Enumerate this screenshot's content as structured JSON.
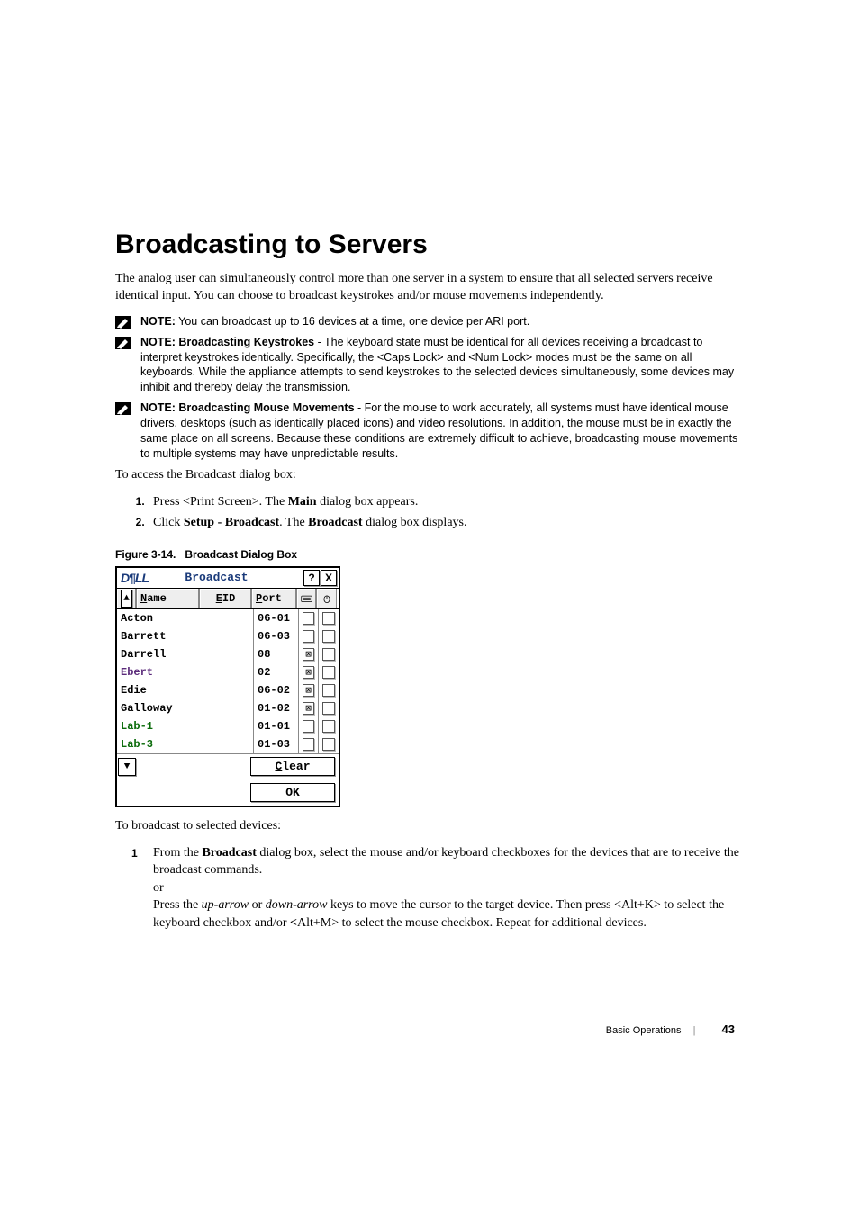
{
  "heading": "Broadcasting to Servers",
  "intro": "The analog user can simultaneously control more than one server in a system to ensure that all selected servers receive identical input. You can choose to broadcast keystrokes and/or mouse movements independently.",
  "notes": [
    {
      "label": "NOTE:",
      "strong": "",
      "text": " You can broadcast up to 16 devices at a time, one device per ARI port."
    },
    {
      "label": "NOTE:",
      "strong": " Broadcasting Keystrokes",
      "text": " - The keyboard state must be identical for all devices receiving a broadcast to interpret keystrokes identically. Specifically, the <Caps Lock> and <Num Lock> modes must be the same on all keyboards. While the appliance attempts to send keystrokes to the selected devices simultaneously, some devices may inhibit and thereby delay the transmission."
    },
    {
      "label": "NOTE:",
      "strong": "  Broadcasting Mouse Movements",
      "text": " - For the mouse to work accurately, all systems must have identical mouse drivers, desktops (such as identically placed icons) and video resolutions. In addition, the mouse must be in exactly the same place on all screens. Because these conditions are extremely difficult to achieve, broadcasting mouse movements to multiple systems may have unpredictable results."
    }
  ],
  "access_line": "To access the Broadcast dialog box:",
  "steps_access": [
    {
      "pre": "Press <Print Screen>. The ",
      "b1": "Main",
      "post": " dialog box appears."
    },
    {
      "pre": "Click ",
      "b1": "Setup - Broadcast",
      "mid": ". The ",
      "b2": "Broadcast",
      "post": " dialog box displays."
    }
  ],
  "fig_caption_pre": "Figure 3-14.",
  "fig_caption": "Broadcast Dialog Box",
  "dialog": {
    "logo": "D¶LL",
    "title": "Broadcast",
    "help": "?",
    "close": "X",
    "headers": {
      "name": "Name",
      "eid": "EID",
      "port": "Port"
    },
    "rows": [
      {
        "name": "Acton",
        "port": "06-01",
        "k": false,
        "m": false,
        "cls": ""
      },
      {
        "name": "Barrett",
        "port": "06-03",
        "k": false,
        "m": false,
        "cls": ""
      },
      {
        "name": "Darrell",
        "port": "08",
        "k": true,
        "m": false,
        "cls": ""
      },
      {
        "name": "Ebert",
        "port": "02",
        "k": true,
        "m": false,
        "cls": "purple"
      },
      {
        "name": "Edie",
        "port": "06-02",
        "k": true,
        "m": false,
        "cls": ""
      },
      {
        "name": "Galloway",
        "port": "01-02",
        "k": true,
        "m": false,
        "cls": ""
      },
      {
        "name": "Lab-1",
        "port": "01-01",
        "k": false,
        "m": false,
        "cls": "green"
      },
      {
        "name": "Lab-3",
        "port": "01-03",
        "k": false,
        "m": false,
        "cls": "green"
      }
    ],
    "clear": "Clear",
    "ok": "OK"
  },
  "broadcast_line": "To broadcast to selected devices:",
  "step_b1_pre": "From the ",
  "step_b1_b": "Broadcast",
  "step_b1_post": " dialog box, select the mouse and/or keyboard checkboxes for the devices that are to receive the broadcast commands.",
  "or": "or",
  "step_b1_alt_a": "Press the ",
  "step_b1_i1": "up-arrow",
  "step_b1_alt_b": " or ",
  "step_b1_i2": "down-arrow",
  "step_b1_alt_c": " keys to move the cursor to the target device. Then press <Alt+K> to select the keyboard checkbox and/or ",
  "step_b1_alt_bold": "<",
  "step_b1_alt_d": "Alt+M> to select the mouse checkbox. Repeat for additional devices.",
  "footer_section": "Basic Operations",
  "footer_page": "43"
}
